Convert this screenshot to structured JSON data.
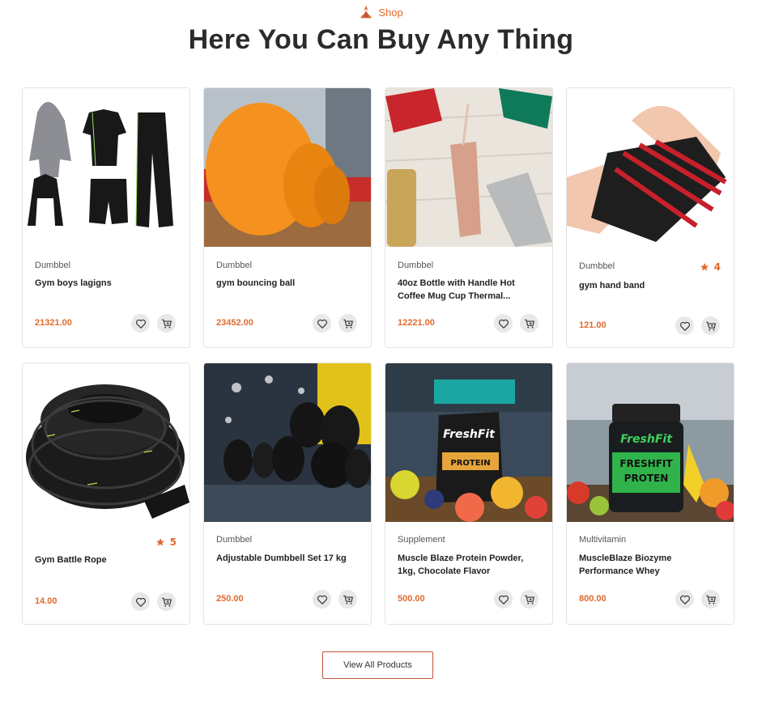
{
  "header": {
    "eyebrow": "Shop",
    "title": "Here You Can Buy Any Thing"
  },
  "products": [
    {
      "category": "Dumbbel",
      "name": "Gym boys lagigns",
      "price": "21321.00",
      "rating": ""
    },
    {
      "category": "Dumbbel",
      "name": "gym bouncing ball",
      "price": "23452.00",
      "rating": ""
    },
    {
      "category": "Dumbbel",
      "name": "40oz Bottle with Handle Hot Coffee Mug Cup Thermal...",
      "price": "12221.00",
      "rating": ""
    },
    {
      "category": "Dumbbel",
      "name": "gym hand band",
      "price": "121.00",
      "rating": "4"
    },
    {
      "category": "",
      "name": "Gym Battle Rope",
      "price": "14.00",
      "rating": "5"
    },
    {
      "category": "Dumbbel",
      "name": "Adjustable Dumbbell Set 17 kg",
      "price": "250.00",
      "rating": ""
    },
    {
      "category": "Supplement",
      "name": "Muscle Blaze Protein Powder, 1kg, Chocolate Flavor",
      "price": "500.00",
      "rating": ""
    },
    {
      "category": "Multivitamin",
      "name": "MuscleBlaze Biozyme Performance Whey",
      "price": "800.00",
      "rating": ""
    }
  ],
  "image_labels": {
    "freshfit": "FreshFit",
    "protein": "PROTEIN",
    "freshfit_caps": "FRESHFIT",
    "proten": "PROTEN"
  },
  "footer": {
    "view_all": "View All Products"
  },
  "icons": {
    "wishlist": "heart-icon",
    "cart": "cart-plus-icon",
    "rating": "star-icon",
    "brand": "fire-logo-icon"
  },
  "colors": {
    "accent": "#e06a2c",
    "border": "#e3e3e3"
  }
}
